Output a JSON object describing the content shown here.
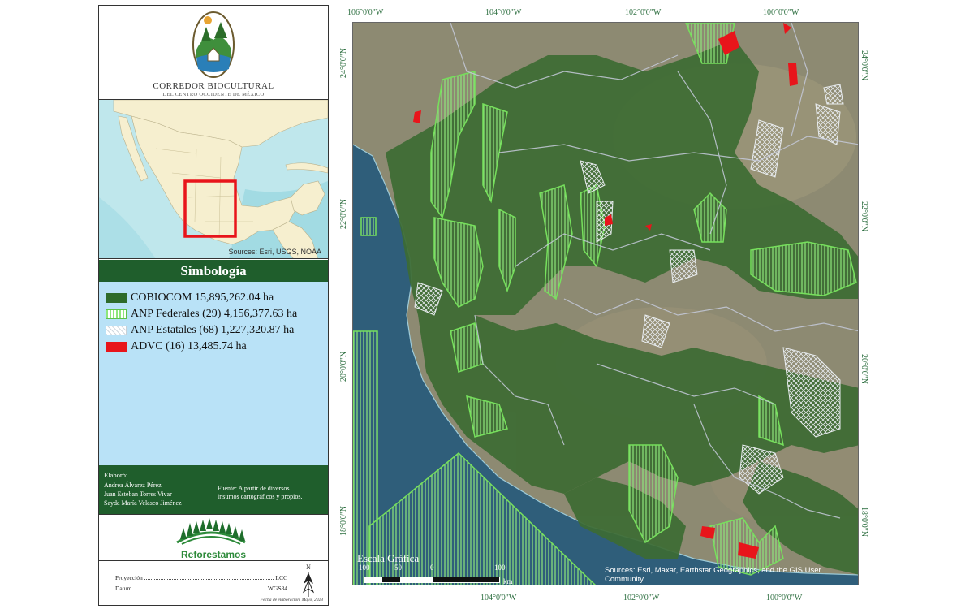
{
  "header": {
    "title": "CORREDOR BIOCULTURAL",
    "subtitle": "DEL CENTRO OCCIDENTE DE MÉXICO"
  },
  "locator_map": {
    "source": "Sources: Esri, USGS, NOAA",
    "frame_color": "#e8151b"
  },
  "legend": {
    "title": "Simbología",
    "items": [
      {
        "label": "COBIOCOM 15,895,262.04 ha",
        "color": "#2e6b2a"
      },
      {
        "label": "ANP Federales (29) 4,156,377.63 ha",
        "color": "#8ee67b"
      },
      {
        "label": "ANP Estatales (68) 1,227,320.87 ha",
        "color": "#cfd7de"
      },
      {
        "label": "ADVC (16) 13,485.74 ha",
        "color": "#e8151b"
      }
    ]
  },
  "credits": {
    "label": "Elaboró:",
    "authors": [
      "Andrea Álvarez Pérez",
      "Juan Esteban Torres Vivar",
      "Sayda María Velasco Jiménez"
    ],
    "source_line1": "Fuente: A partir de diversos",
    "source_line2": "insumos cartográficos y propios."
  },
  "partner": {
    "name": "Reforestamos"
  },
  "projection": {
    "proj_label": "Proyección",
    "proj_value": "LCC",
    "datum_label": "Datum",
    "datum_value": "WGS84",
    "date": "Fecha de elaboración, Mayo, 2023"
  },
  "map": {
    "lon_ticks": [
      "106°0'0\"W",
      "104°0'0\"W",
      "102°0'0\"W",
      "100°0'0\"W"
    ],
    "lat_ticks": [
      "24°0'0\"N",
      "22°0'0\"N",
      "20°0'0\"N",
      "18°0'0\"N"
    ],
    "scale_title": "Escala Gráfica",
    "scale_labels": [
      "100",
      "50",
      "0",
      "100"
    ],
    "scale_unit": "km",
    "source": "Sources: Esri, Maxar, Earthstar Geographics, and the GIS User Community"
  }
}
